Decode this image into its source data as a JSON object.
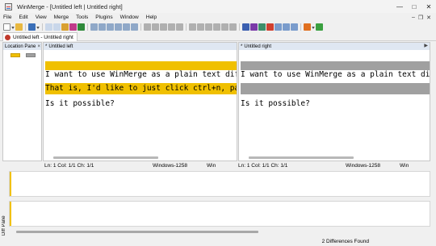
{
  "window": {
    "title": "WinMerge - [Untitled left | Untitled right]"
  },
  "menu": {
    "items": [
      "File",
      "Edit",
      "View",
      "Merge",
      "Tools",
      "Plugins",
      "Window",
      "Help"
    ]
  },
  "tabs": {
    "active_label": "Untitled left - Untitled right"
  },
  "location_pane": {
    "title": "Location Pane",
    "close_glyph": "×"
  },
  "left_pane": {
    "title": "Untitled left",
    "lines": [
      "",
      "I want to use WinMerge as a plain text diff tool.",
      "That is, I'd like to just click ctrl+n, paste the text",
      "Is it possible?"
    ],
    "status": {
      "position": "Ln: 1  Col: 1/1  Ch: 1/1",
      "encoding": "Windows-1258",
      "eol": "Win"
    }
  },
  "right_pane": {
    "title": "Untitled right",
    "lines": [
      "",
      "I want to use WinMerge as a plain text diff tool.",
      "",
      "Is it possible?"
    ],
    "status": {
      "position": "Ln: 1  Col: 1/1  Ch: 1/1",
      "encoding": "Windows-1258",
      "eol": "Win"
    }
  },
  "diff_pane": {
    "label": "Diff Pane"
  },
  "statusbar": {
    "differences": "2 Differences Found"
  },
  "colors": {
    "diff_highlight": "#f0c000",
    "diff_missing": "#a0a0a0",
    "pane_header": "#dfe7f2"
  }
}
